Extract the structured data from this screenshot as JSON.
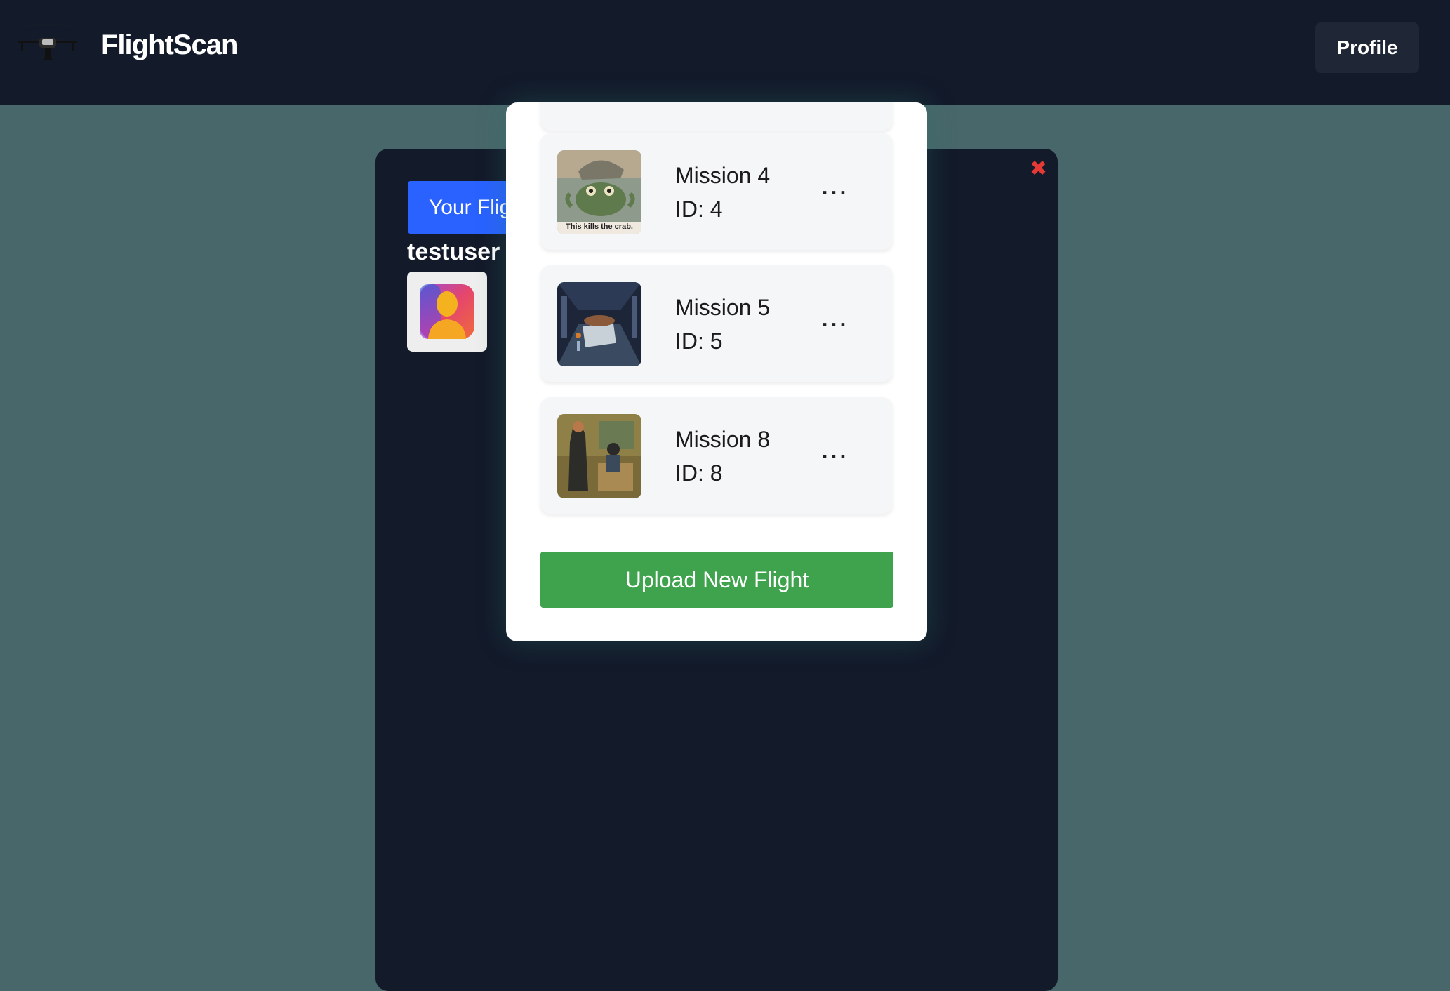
{
  "header": {
    "brand_name": "FlightScan",
    "profile_label": "Profile"
  },
  "panel": {
    "tab_label": "Your Flig",
    "username": "testuser",
    "close_icon": "close-icon"
  },
  "modal": {
    "missions": [
      {
        "title": "Mission 4",
        "id_label": "ID: 4",
        "menu": "...",
        "thumb_caption": "This kills the crab."
      },
      {
        "title": "Mission 5",
        "id_label": "ID: 5",
        "menu": "..."
      },
      {
        "title": "Mission 8",
        "id_label": "ID: 8",
        "menu": "..."
      }
    ],
    "upload_label": "Upload New Flight"
  },
  "colors": {
    "topbar": "#131a2a",
    "background": "#48676a",
    "accent_blue": "#2962ff",
    "upload_green": "#3fa34d",
    "close_red": "#e53935"
  }
}
